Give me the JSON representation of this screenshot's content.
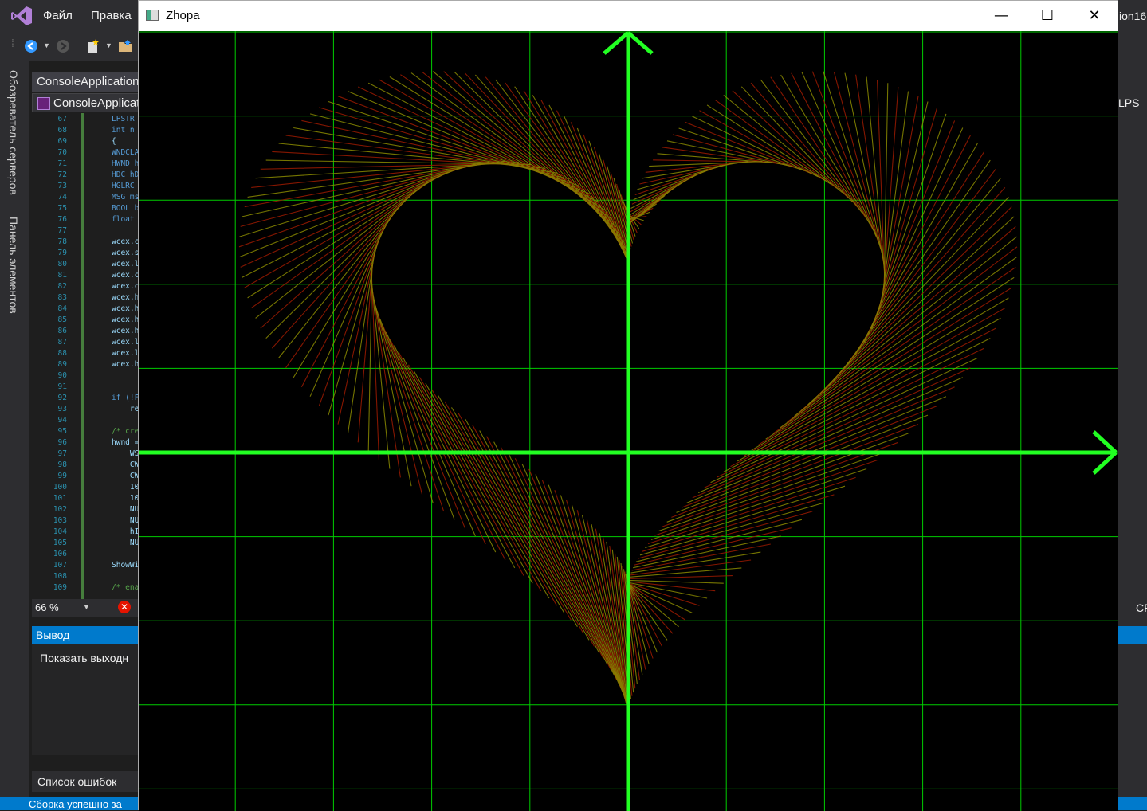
{
  "vs": {
    "menu": [
      "Файл",
      "Правка"
    ],
    "doc_tab": "ConsoleApplication",
    "nav_combo": "ConsoleApplicat",
    "side_tabs": [
      "Обозреватель серверов",
      "Панель элементов"
    ],
    "line_numbers": [
      "67",
      "68",
      "69",
      "70",
      "71",
      "72",
      "73",
      "74",
      "75",
      "76",
      "77",
      "78",
      "79",
      "80",
      "81",
      "82",
      "83",
      "84",
      "85",
      "86",
      "87",
      "88",
      "89",
      "90",
      "91",
      "92",
      "93",
      "94",
      "95",
      "96",
      "97",
      "98",
      "99",
      "100",
      "101",
      "102",
      "103",
      "104",
      "105",
      "106",
      "107",
      "108",
      "109"
    ],
    "code_lines": [
      "LPSTR",
      "int n",
      "{",
      "WNDCLA",
      "HWND h",
      "HDC hD",
      "HGLRC",
      "MSG ms",
      "BOOL b",
      "float",
      "",
      "wcex.c",
      "wcex.s",
      "wcex.l",
      "wcex.c",
      "wcex.c",
      "wcex.h",
      "wcex.h",
      "wcex.h",
      "wcex.h",
      "wcex.l",
      "wcex.l",
      "wcex.h",
      "",
      "",
      "if (!F",
      "    re",
      "",
      "/* cre",
      "hwnd =",
      "    WS",
      "    CW",
      "    CW",
      "    10",
      "    10",
      "    NU",
      "    NU",
      "    hI",
      "    NU",
      "",
      "ShowWi",
      "",
      "/* ena"
    ],
    "zoom": "66 %",
    "output_title": "Вывод",
    "output_show": "Показать выходн",
    "error_list_tab": "Список ошибок",
    "status": "Сборка успешно за",
    "right_fragments": [
      "ion16",
      "LPS",
      "CF"
    ]
  },
  "window": {
    "title": "Zhopa",
    "minimize_glyph": "—",
    "maximize_glyph": "☐",
    "close_glyph": "✕"
  },
  "colors": {
    "grid": "#00cc00",
    "axis": "#22ff22",
    "heart_red": "#9b1a00",
    "heart_green": "#8a8a00",
    "status_blue": "#007acc"
  },
  "icons": [
    "vs-logo-icon",
    "back-arrow-icon",
    "forward-arrow-icon",
    "new-project-icon",
    "open-folder-icon",
    "error-icon",
    "app-window-icon"
  ]
}
